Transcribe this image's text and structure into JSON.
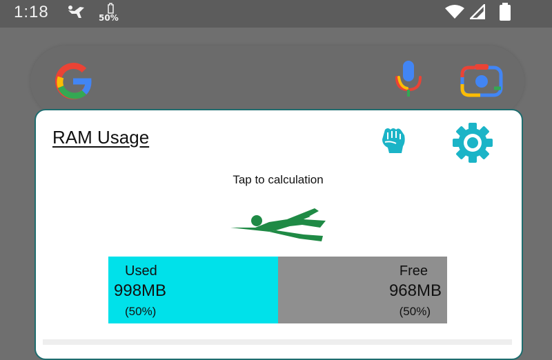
{
  "status_bar": {
    "time": "1:18",
    "battery_saver_label": "50%",
    "icons": [
      "runner-icon",
      "battery-saver-icon",
      "wifi-icon",
      "cell-signal-icon",
      "battery-icon"
    ]
  },
  "search_bar": {
    "icons": [
      "google-logo",
      "mic-icon",
      "lens-icon"
    ],
    "colors": {
      "blue": "#4285F4",
      "red": "#EA4335",
      "yellow": "#FBBC05",
      "green": "#34A853"
    }
  },
  "widget": {
    "title": "RAM Usage",
    "hint": "Tap to calculation",
    "icons": [
      "fist-icon",
      "gear-icon",
      "runner-illustration"
    ],
    "accent_color": "#00e1ea",
    "illustration_color": "#1f8a45",
    "used": {
      "label": "Used",
      "size": "998MB",
      "percent": "(50%)"
    },
    "free": {
      "label": "Free",
      "size": "968MB",
      "percent": "(50%)"
    },
    "used_fraction": 0.5
  }
}
